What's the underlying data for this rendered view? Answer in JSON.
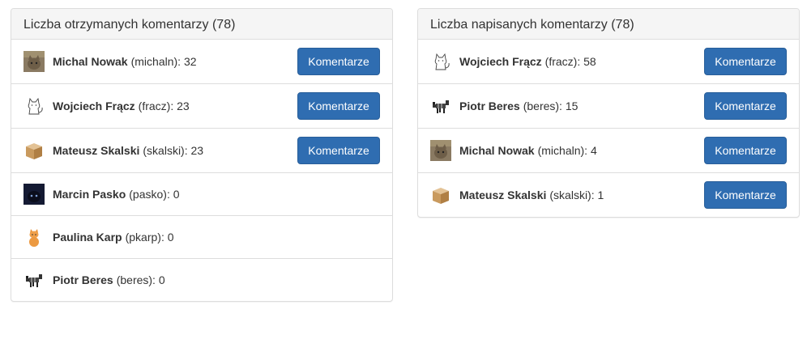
{
  "received": {
    "title": "Liczba otrzymanych komentarzy (78)",
    "items": [
      {
        "name": "Michal Nowak",
        "login": "(michaln):",
        "count": "32",
        "button": "Komentarze",
        "avatar": "cat-photo-avatar"
      },
      {
        "name": "Wojciech Frącz",
        "login": "(fracz):",
        "count": "23",
        "button": "Komentarze",
        "avatar": "cat-sketch-avatar"
      },
      {
        "name": "Mateusz Skalski",
        "login": "(skalski):",
        "count": "23",
        "button": "Komentarze",
        "avatar": "box-avatar"
      },
      {
        "name": "Marcin Pasko",
        "login": "(pasko):",
        "count": "0",
        "avatar": "black-cat-avatar"
      },
      {
        "name": "Paulina Karp",
        "login": "(pkarp):",
        "count": "0",
        "avatar": "kitten-avatar"
      },
      {
        "name": "Piotr Beres",
        "login": "(beres):",
        "count": "0",
        "avatar": "pixel-cat-avatar"
      }
    ]
  },
  "written": {
    "title": "Liczba napisanych komentarzy (78)",
    "items": [
      {
        "name": "Wojciech Frącz",
        "login": "(fracz):",
        "count": "58",
        "button": "Komentarze",
        "avatar": "cat-sketch-avatar"
      },
      {
        "name": "Piotr Beres",
        "login": "(beres):",
        "count": "15",
        "button": "Komentarze",
        "avatar": "pixel-cat-avatar"
      },
      {
        "name": "Michal Nowak",
        "login": "(michaln):",
        "count": "4",
        "button": "Komentarze",
        "avatar": "cat-photo-avatar"
      },
      {
        "name": "Mateusz Skalski",
        "login": "(skalski):",
        "count": "1",
        "button": "Komentarze",
        "avatar": "box-avatar"
      }
    ]
  },
  "colors": {
    "button": "#2f6db1",
    "heading_bg": "#f5f5f5",
    "border": "#dddddd"
  }
}
